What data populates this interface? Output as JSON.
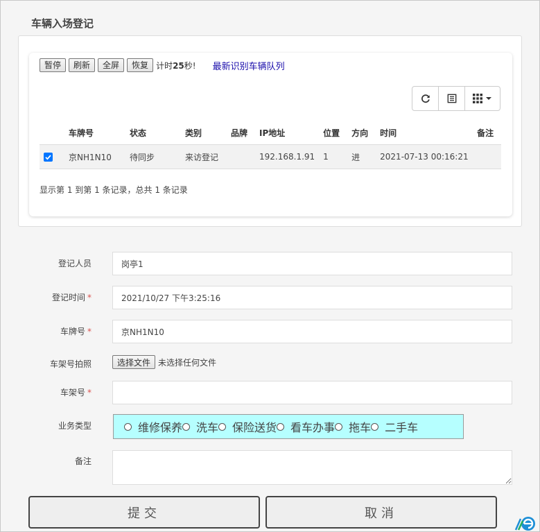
{
  "page_title": "车辆入场登记",
  "toolbar": {
    "buttons": [
      "暂停",
      "刷新",
      "全屏",
      "恢复"
    ],
    "timer_prefix": "计时",
    "timer_value": "25",
    "timer_suffix": "秒!",
    "queue_link": "最新识别车辆队列"
  },
  "table": {
    "headers": [
      "",
      "车牌号",
      "状态",
      "类别",
      "品牌",
      "IP地址",
      "位置",
      "方向",
      "时间",
      "备注"
    ],
    "rows": [
      {
        "checked": true,
        "plate": "京NH1N10",
        "status": "待同步",
        "category": "来访登记",
        "brand": "",
        "ip": "192.168.1.91",
        "position": "1",
        "direction": "进",
        "time": "2021-07-13 00:16:21",
        "remark": ""
      }
    ],
    "summary": "显示第 1 到第 1 条记录，总共 1 条记录"
  },
  "form": {
    "registrar_label": "登记人员",
    "registrar_value": "岗亭1",
    "time_label": "登记时间",
    "time_value": "2021/10/27 下午3:25:16",
    "plate_label": "车牌号",
    "plate_value": "京NH1N10",
    "photo_label": "车架号拍照",
    "file_button": "选择文件",
    "file_status": "未选择任何文件",
    "vin_label": "车架号",
    "vin_value": "",
    "business_label": "业务类型",
    "business_options": [
      "维修保养",
      "洗车",
      "保险送货",
      "看车办事",
      "拖车",
      "二手车"
    ],
    "remark_label": "备注",
    "required_mark": "*"
  },
  "actions": {
    "submit": "提交",
    "cancel": "取消"
  },
  "colors": {
    "radio_bg": "#b6ffff",
    "required": "#d9534f",
    "link": "#1a0dab"
  }
}
